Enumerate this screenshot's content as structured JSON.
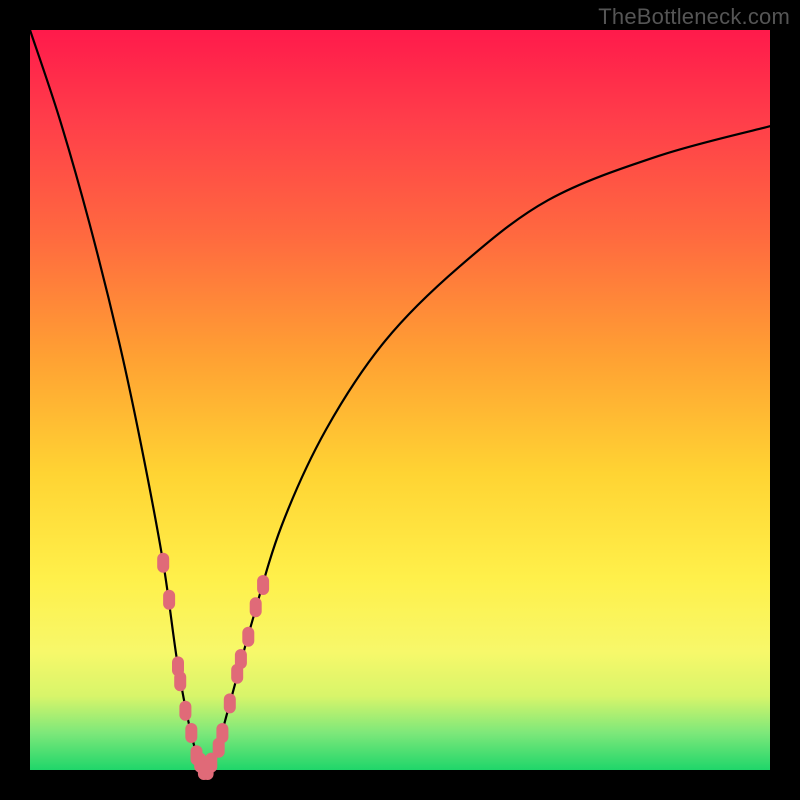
{
  "watermark": "TheBottleneck.com",
  "chart_data": {
    "type": "line",
    "title": "",
    "xlabel": "",
    "ylabel": "",
    "xlim": [
      0,
      100
    ],
    "ylim": [
      0,
      100
    ],
    "grid": false,
    "series": [
      {
        "name": "bottleneck-curve",
        "x": [
          0,
          4,
          8,
          12,
          15,
          18,
          20,
          22,
          23.5,
          25,
          27,
          30,
          34,
          40,
          48,
          58,
          70,
          85,
          100
        ],
        "values": [
          100,
          88,
          74,
          58,
          44,
          28,
          14,
          4,
          0,
          2,
          9,
          20,
          33,
          46,
          58,
          68,
          77,
          83,
          87
        ]
      }
    ],
    "markers": {
      "name": "highlight-points",
      "color": "#e06a78",
      "points": [
        {
          "x": 18.0,
          "y": 28
        },
        {
          "x": 18.8,
          "y": 23
        },
        {
          "x": 20.0,
          "y": 14
        },
        {
          "x": 20.3,
          "y": 12
        },
        {
          "x": 21.0,
          "y": 8
        },
        {
          "x": 21.8,
          "y": 5
        },
        {
          "x": 22.5,
          "y": 2
        },
        {
          "x": 23.0,
          "y": 1
        },
        {
          "x": 23.5,
          "y": 0
        },
        {
          "x": 24.0,
          "y": 0
        },
        {
          "x": 24.5,
          "y": 1
        },
        {
          "x": 25.5,
          "y": 3
        },
        {
          "x": 26.0,
          "y": 5
        },
        {
          "x": 27.0,
          "y": 9
        },
        {
          "x": 28.0,
          "y": 13
        },
        {
          "x": 28.5,
          "y": 15
        },
        {
          "x": 29.5,
          "y": 18
        },
        {
          "x": 30.5,
          "y": 22
        },
        {
          "x": 31.5,
          "y": 25
        }
      ]
    }
  }
}
